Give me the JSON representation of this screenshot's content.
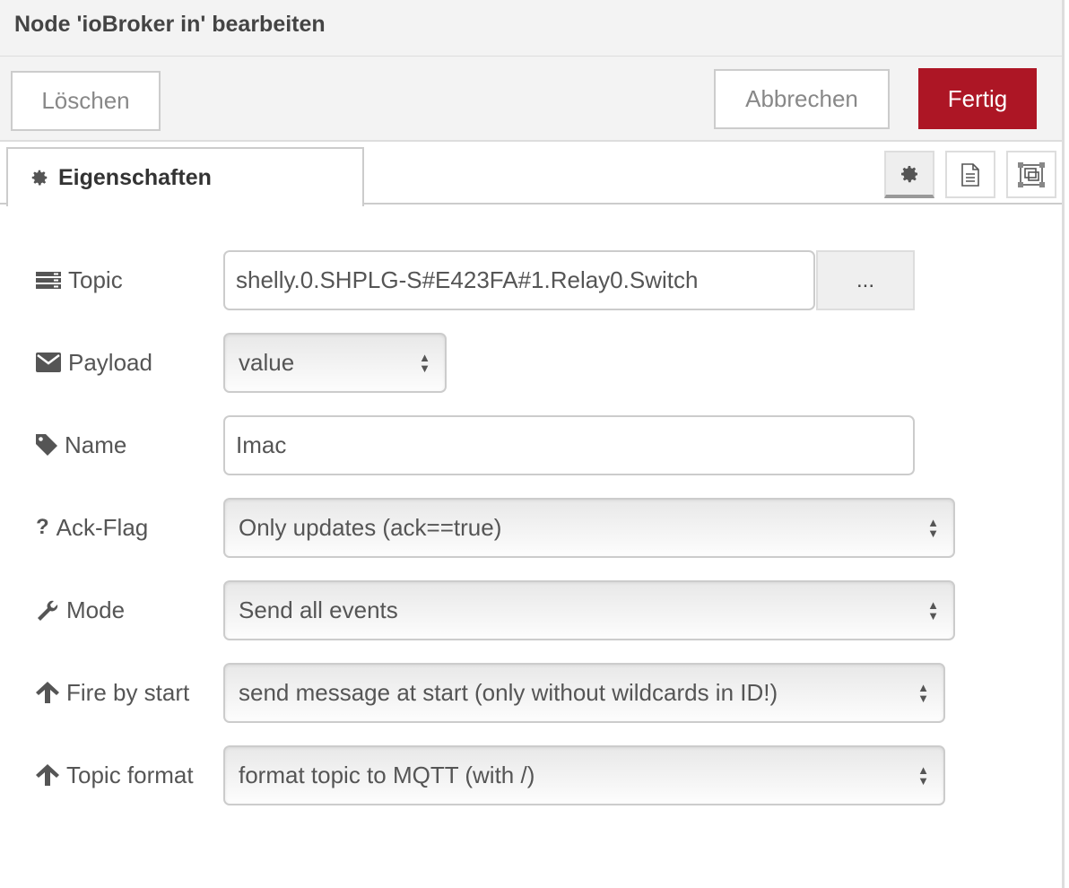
{
  "header": {
    "title": "Node 'ioBroker in' bearbeiten"
  },
  "tray": {
    "delete_label": "Löschen",
    "cancel_label": "Abbrechen",
    "done_label": "Fertig",
    "done_color": "#ad1625"
  },
  "tabs": {
    "properties_label": "Eigenschaften",
    "icons": [
      "gear-icon",
      "document-icon",
      "frame-icon"
    ]
  },
  "form": {
    "topic": {
      "label": "Topic",
      "value": "shelly.0.SHPLG-S#E423FA#1.Relay0.Switch",
      "browse_label": "..."
    },
    "payload": {
      "label": "Payload",
      "value": "value"
    },
    "name": {
      "label": "Name",
      "value": "Imac"
    },
    "ack": {
      "label": "Ack-Flag",
      "value": "Only updates (ack==true)"
    },
    "mode": {
      "label": "Mode",
      "value": "Send all events"
    },
    "fire": {
      "label": "Fire by start",
      "value": "send message at start (only without wildcards in ID!)"
    },
    "topic_format": {
      "label": "Topic format",
      "value": "format topic to MQTT (with /)"
    }
  }
}
